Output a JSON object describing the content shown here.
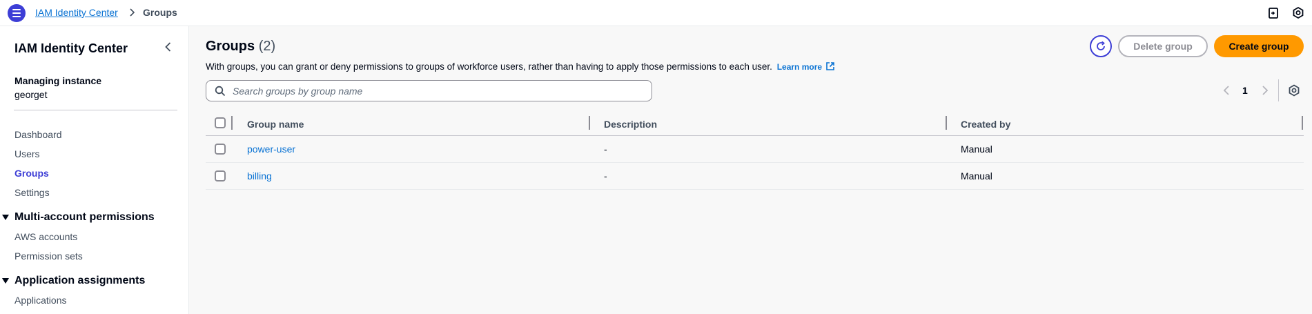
{
  "topbar": {
    "breadcrumb_link": "IAM Identity Center",
    "breadcrumb_current": "Groups"
  },
  "sidebar": {
    "title": "IAM Identity Center",
    "instance_label": "Managing instance",
    "instance_value": "georget",
    "nav": [
      {
        "label": "Dashboard"
      },
      {
        "label": "Users"
      },
      {
        "label": "Groups",
        "active": true
      },
      {
        "label": "Settings"
      }
    ],
    "sections": [
      {
        "label": "Multi-account permissions",
        "items": [
          {
            "label": "AWS accounts"
          },
          {
            "label": "Permission sets"
          }
        ]
      },
      {
        "label": "Application assignments",
        "items": [
          {
            "label": "Applications"
          }
        ]
      }
    ]
  },
  "main": {
    "title": "Groups",
    "count": "(2)",
    "description": "With groups, you can grant or deny permissions to groups of workforce users, rather than having to apply those permissions to each user.",
    "learn_more": "Learn more",
    "delete_button": "Delete group",
    "create_button": "Create group",
    "search_placeholder": "Search groups by group name",
    "page_number": "1",
    "columns": [
      "Group name",
      "Description",
      "Created by"
    ],
    "rows": [
      {
        "name": "power-user",
        "description": "-",
        "created_by": "Manual"
      },
      {
        "name": "billing",
        "description": "-",
        "created_by": "Manual"
      }
    ]
  },
  "colors": {
    "accent": "#3d3ed6",
    "link": "#0972d3",
    "primary_button": "#ff9900",
    "text": "#000716"
  },
  "icons": [
    "menu-icon",
    "chevron-right-icon",
    "notifications-icon",
    "settings-icon",
    "collapse-left-icon",
    "caret-down-icon",
    "external-link-icon",
    "refresh-icon",
    "search-icon",
    "chevron-left-icon",
    "gear-icon"
  ]
}
